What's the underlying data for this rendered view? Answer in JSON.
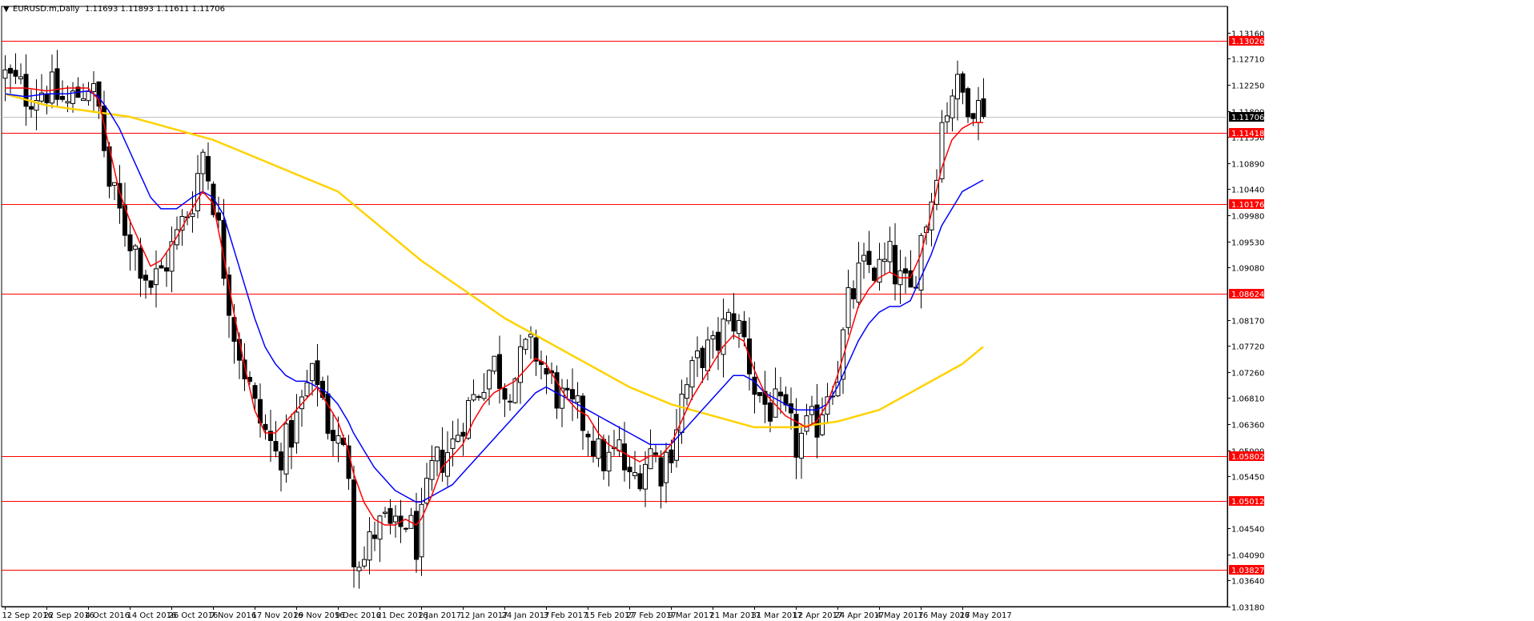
{
  "header": {
    "arrow": "▼",
    "symbol": "EURUSD.m,Daily",
    "ohlc": "1.11693 1.11893 1.11611 1.11706"
  },
  "chart_data": {
    "type": "candlestick",
    "symbol": "EURUSD.m",
    "timeframe": "Daily",
    "ylim": [
      1.0318,
      1.1362
    ],
    "price_ticks": [
      "1.13160",
      "1.12710",
      "1.12250",
      "1.11800",
      "1.11350",
      "1.10890",
      "1.10440",
      "1.09980",
      "1.09530",
      "1.09080",
      "1.08170",
      "1.07720",
      "1.07260",
      "1.06810",
      "1.06360",
      "1.05900",
      "1.05450",
      "1.04540",
      "1.04090",
      "1.03640",
      "1.03180"
    ],
    "date_ticks": [
      {
        "label": "12 Sep 2016",
        "i": 0
      },
      {
        "label": "22 Sep 2016",
        "i": 8
      },
      {
        "label": "4 Oct 2016",
        "i": 16
      },
      {
        "label": "14 Oct 2016",
        "i": 24
      },
      {
        "label": "26 Oct 2016",
        "i": 32
      },
      {
        "label": "7 Nov 2016",
        "i": 40
      },
      {
        "label": "17 Nov 2016",
        "i": 48
      },
      {
        "label": "29 Nov 2016",
        "i": 56
      },
      {
        "label": "9 Dec 2016",
        "i": 64
      },
      {
        "label": "21 Dec 2016",
        "i": 72
      },
      {
        "label": "2 Jan 2017",
        "i": 80
      },
      {
        "label": "12 Jan 2017",
        "i": 88
      },
      {
        "label": "24 Jan 2017",
        "i": 96
      },
      {
        "label": "3 Feb 2017",
        "i": 104
      },
      {
        "label": "15 Feb 2017",
        "i": 112
      },
      {
        "label": "27 Feb 2017",
        "i": 120
      },
      {
        "label": "9 Mar 2017",
        "i": 128
      },
      {
        "label": "21 Mar 2017",
        "i": 136
      },
      {
        "label": "31 Mar 2017",
        "i": 144
      },
      {
        "label": "12 Apr 2017",
        "i": 152
      },
      {
        "label": "24 Apr 2017",
        "i": 160
      },
      {
        "label": "4 May 2017",
        "i": 168
      },
      {
        "label": "16 May 2017",
        "i": 176
      },
      {
        "label": "26 May 2017",
        "i": 184
      }
    ],
    "horizontal_levels": [
      {
        "price": 1.13026,
        "label": "1.13026"
      },
      {
        "price": 1.11418,
        "label": "1.11418"
      },
      {
        "price": 1.10176,
        "label": "1.10176"
      },
      {
        "price": 1.08624,
        "label": "1.08624"
      },
      {
        "price": 1.05802,
        "label": "1.05802"
      },
      {
        "price": 1.05012,
        "label": "1.05012"
      },
      {
        "price": 1.03827,
        "label": "1.03827"
      }
    ],
    "current_price": {
      "price": 1.11706,
      "label": "1.11706"
    },
    "anchors": [
      [
        0,
        1.124
      ],
      [
        4,
        1.121
      ],
      [
        8,
        1.122
      ],
      [
        12,
        1.119
      ],
      [
        16,
        1.123
      ],
      [
        18,
        1.118
      ],
      [
        20,
        1.105
      ],
      [
        22,
        1.1
      ],
      [
        24,
        1.096
      ],
      [
        26,
        1.092
      ],
      [
        28,
        1.088
      ],
      [
        30,
        1.09
      ],
      [
        33,
        1.096
      ],
      [
        36,
        1.103
      ],
      [
        38,
        1.111
      ],
      [
        40,
        1.103
      ],
      [
        42,
        1.091
      ],
      [
        44,
        1.08
      ],
      [
        46,
        1.073
      ],
      [
        48,
        1.066
      ],
      [
        50,
        1.062
      ],
      [
        52,
        1.058
      ],
      [
        54,
        1.06
      ],
      [
        56,
        1.064
      ],
      [
        58,
        1.07
      ],
      [
        60,
        1.072
      ],
      [
        62,
        1.064
      ],
      [
        64,
        1.06
      ],
      [
        66,
        1.056
      ],
      [
        67,
        1.042
      ],
      [
        69,
        1.04
      ],
      [
        71,
        1.045
      ],
      [
        73,
        1.046
      ],
      [
        75,
        1.044
      ],
      [
        77,
        1.047
      ],
      [
        79,
        1.043
      ],
      [
        80,
        1.046
      ],
      [
        82,
        1.055
      ],
      [
        84,
        1.058
      ],
      [
        86,
        1.06
      ],
      [
        88,
        1.065
      ],
      [
        90,
        1.068
      ],
      [
        92,
        1.072
      ],
      [
        94,
        1.074
      ],
      [
        96,
        1.07
      ],
      [
        98,
        1.072
      ],
      [
        100,
        1.076
      ],
      [
        102,
        1.076
      ],
      [
        104,
        1.072
      ],
      [
        106,
        1.069
      ],
      [
        108,
        1.066
      ],
      [
        110,
        1.065
      ],
      [
        112,
        1.063
      ],
      [
        114,
        1.058
      ],
      [
        116,
        1.057
      ],
      [
        118,
        1.059
      ],
      [
        120,
        1.053
      ],
      [
        122,
        1.056
      ],
      [
        124,
        1.059
      ],
      [
        126,
        1.056
      ],
      [
        128,
        1.06
      ],
      [
        130,
        1.068
      ],
      [
        132,
        1.072
      ],
      [
        134,
        1.076
      ],
      [
        136,
        1.076
      ],
      [
        138,
        1.08
      ],
      [
        140,
        1.082
      ],
      [
        142,
        1.078
      ],
      [
        144,
        1.07
      ],
      [
        146,
        1.067
      ],
      [
        148,
        1.066
      ],
      [
        150,
        1.064
      ],
      [
        152,
        1.06
      ],
      [
        154,
        1.062
      ],
      [
        156,
        1.064
      ],
      [
        158,
        1.07
      ],
      [
        160,
        1.073
      ],
      [
        162,
        1.084
      ],
      [
        164,
        1.089
      ],
      [
        166,
        1.091
      ],
      [
        168,
        1.09
      ],
      [
        170,
        1.092
      ],
      [
        172,
        1.088
      ],
      [
        174,
        1.086
      ],
      [
        176,
        1.096
      ],
      [
        178,
        1.103
      ],
      [
        180,
        1.116
      ],
      [
        182,
        1.122
      ],
      [
        184,
        1.121
      ],
      [
        186,
        1.12
      ],
      [
        188,
        1.117
      ]
    ],
    "ma_fast": [
      [
        0,
        1.122
      ],
      [
        4,
        1.122
      ],
      [
        8,
        1.1215
      ],
      [
        12,
        1.122
      ],
      [
        16,
        1.122
      ],
      [
        18,
        1.12
      ],
      [
        20,
        1.112
      ],
      [
        22,
        1.104
      ],
      [
        24,
        1.099
      ],
      [
        26,
        1.095
      ],
      [
        28,
        1.091
      ],
      [
        30,
        1.092
      ],
      [
        33,
        1.096
      ],
      [
        36,
        1.101
      ],
      [
        38,
        1.104
      ],
      [
        40,
        1.102
      ],
      [
        42,
        1.093
      ],
      [
        44,
        1.083
      ],
      [
        46,
        1.074
      ],
      [
        48,
        1.066
      ],
      [
        50,
        1.062
      ],
      [
        52,
        1.062
      ],
      [
        54,
        1.064
      ],
      [
        56,
        1.066
      ],
      [
        58,
        1.068
      ],
      [
        60,
        1.07
      ],
      [
        62,
        1.067
      ],
      [
        64,
        1.064
      ],
      [
        66,
        1.059
      ],
      [
        67,
        1.055
      ],
      [
        69,
        1.05
      ],
      [
        71,
        1.047
      ],
      [
        73,
        1.046
      ],
      [
        75,
        1.046
      ],
      [
        77,
        1.047
      ],
      [
        79,
        1.046
      ],
      [
        80,
        1.047
      ],
      [
        82,
        1.051
      ],
      [
        84,
        1.056
      ],
      [
        86,
        1.058
      ],
      [
        88,
        1.06
      ],
      [
        90,
        1.064
      ],
      [
        92,
        1.067
      ],
      [
        94,
        1.069
      ],
      [
        96,
        1.07
      ],
      [
        98,
        1.071
      ],
      [
        100,
        1.073
      ],
      [
        102,
        1.075
      ],
      [
        104,
        1.074
      ],
      [
        106,
        1.071
      ],
      [
        108,
        1.068
      ],
      [
        110,
        1.066
      ],
      [
        112,
        1.065
      ],
      [
        114,
        1.062
      ],
      [
        116,
        1.06
      ],
      [
        118,
        1.059
      ],
      [
        120,
        1.058
      ],
      [
        122,
        1.057
      ],
      [
        124,
        1.058
      ],
      [
        126,
        1.058
      ],
      [
        128,
        1.06
      ],
      [
        130,
        1.064
      ],
      [
        132,
        1.068
      ],
      [
        134,
        1.071
      ],
      [
        136,
        1.074
      ],
      [
        138,
        1.077
      ],
      [
        140,
        1.079
      ],
      [
        142,
        1.078
      ],
      [
        144,
        1.073
      ],
      [
        146,
        1.069
      ],
      [
        148,
        1.067
      ],
      [
        150,
        1.065
      ],
      [
        152,
        1.064
      ],
      [
        154,
        1.063
      ],
      [
        156,
        1.064
      ],
      [
        158,
        1.067
      ],
      [
        160,
        1.072
      ],
      [
        162,
        1.078
      ],
      [
        164,
        1.084
      ],
      [
        166,
        1.087
      ],
      [
        168,
        1.089
      ],
      [
        170,
        1.09
      ],
      [
        172,
        1.089
      ],
      [
        174,
        1.089
      ],
      [
        176,
        1.093
      ],
      [
        178,
        1.1
      ],
      [
        180,
        1.108
      ],
      [
        182,
        1.113
      ],
      [
        184,
        1.115
      ],
      [
        186,
        1.116
      ],
      [
        188,
        1.116
      ]
    ],
    "ma_mid": [
      [
        0,
        1.121
      ],
      [
        4,
        1.1205
      ],
      [
        8,
        1.121
      ],
      [
        12,
        1.121
      ],
      [
        16,
        1.1215
      ],
      [
        18,
        1.1205
      ],
      [
        20,
        1.118
      ],
      [
        22,
        1.115
      ],
      [
        24,
        1.111
      ],
      [
        26,
        1.107
      ],
      [
        28,
        1.103
      ],
      [
        30,
        1.101
      ],
      [
        33,
        1.101
      ],
      [
        36,
        1.103
      ],
      [
        38,
        1.104
      ],
      [
        40,
        1.103
      ],
      [
        42,
        1.1
      ],
      [
        44,
        1.094
      ],
      [
        46,
        1.088
      ],
      [
        48,
        1.082
      ],
      [
        50,
        1.077
      ],
      [
        52,
        1.074
      ],
      [
        54,
        1.072
      ],
      [
        56,
        1.071
      ],
      [
        58,
        1.071
      ],
      [
        60,
        1.07
      ],
      [
        62,
        1.069
      ],
      [
        64,
        1.067
      ],
      [
        66,
        1.064
      ],
      [
        67,
        1.062
      ],
      [
        69,
        1.059
      ],
      [
        71,
        1.056
      ],
      [
        73,
        1.054
      ],
      [
        75,
        1.052
      ],
      [
        77,
        1.051
      ],
      [
        79,
        1.05
      ],
      [
        80,
        1.05
      ],
      [
        82,
        1.051
      ],
      [
        84,
        1.052
      ],
      [
        86,
        1.053
      ],
      [
        88,
        1.055
      ],
      [
        90,
        1.057
      ],
      [
        92,
        1.059
      ],
      [
        94,
        1.061
      ],
      [
        96,
        1.063
      ],
      [
        98,
        1.065
      ],
      [
        100,
        1.067
      ],
      [
        102,
        1.069
      ],
      [
        104,
        1.07
      ],
      [
        106,
        1.069
      ],
      [
        108,
        1.068
      ],
      [
        110,
        1.067
      ],
      [
        112,
        1.066
      ],
      [
        114,
        1.065
      ],
      [
        116,
        1.064
      ],
      [
        118,
        1.063
      ],
      [
        120,
        1.062
      ],
      [
        122,
        1.061
      ],
      [
        124,
        1.06
      ],
      [
        126,
        1.06
      ],
      [
        128,
        1.06
      ],
      [
        130,
        1.062
      ],
      [
        132,
        1.064
      ],
      [
        134,
        1.066
      ],
      [
        136,
        1.068
      ],
      [
        138,
        1.07
      ],
      [
        140,
        1.072
      ],
      [
        142,
        1.072
      ],
      [
        144,
        1.071
      ],
      [
        146,
        1.069
      ],
      [
        148,
        1.068
      ],
      [
        150,
        1.067
      ],
      [
        152,
        1.066
      ],
      [
        154,
        1.066
      ],
      [
        156,
        1.066
      ],
      [
        158,
        1.067
      ],
      [
        160,
        1.07
      ],
      [
        162,
        1.074
      ],
      [
        164,
        1.078
      ],
      [
        166,
        1.081
      ],
      [
        168,
        1.083
      ],
      [
        170,
        1.084
      ],
      [
        172,
        1.084
      ],
      [
        174,
        1.085
      ],
      [
        176,
        1.089
      ],
      [
        178,
        1.093
      ],
      [
        180,
        1.098
      ],
      [
        182,
        1.101
      ],
      [
        184,
        1.104
      ],
      [
        186,
        1.105
      ],
      [
        188,
        1.106
      ]
    ],
    "ma_slow": [
      [
        0,
        1.121
      ],
      [
        8,
        1.119
      ],
      [
        16,
        1.118
      ],
      [
        24,
        1.117
      ],
      [
        32,
        1.115
      ],
      [
        40,
        1.113
      ],
      [
        48,
        1.11
      ],
      [
        56,
        1.107
      ],
      [
        64,
        1.104
      ],
      [
        72,
        1.098
      ],
      [
        80,
        1.092
      ],
      [
        88,
        1.087
      ],
      [
        96,
        1.082
      ],
      [
        104,
        1.078
      ],
      [
        112,
        1.074
      ],
      [
        120,
        1.07
      ],
      [
        128,
        1.067
      ],
      [
        136,
        1.065
      ],
      [
        144,
        1.063
      ],
      [
        152,
        1.063
      ],
      [
        160,
        1.064
      ],
      [
        168,
        1.066
      ],
      [
        176,
        1.07
      ],
      [
        184,
        1.074
      ],
      [
        188,
        1.077
      ]
    ],
    "series": [
      {
        "color": "#ff0000"
      },
      {
        "color": "#0000ff"
      },
      {
        "color": "#ffd200"
      }
    ],
    "colors": {
      "bull_body": "#ffffff",
      "bear_body": "#000000",
      "candle_outline": "#000000",
      "level_line": "#ff0000",
      "level_label_bg": "#ff0000",
      "level_label_text": "#ffffff",
      "current_label_bg": "#000000",
      "current_label_text": "#ffffff",
      "axis": "#000000"
    }
  }
}
